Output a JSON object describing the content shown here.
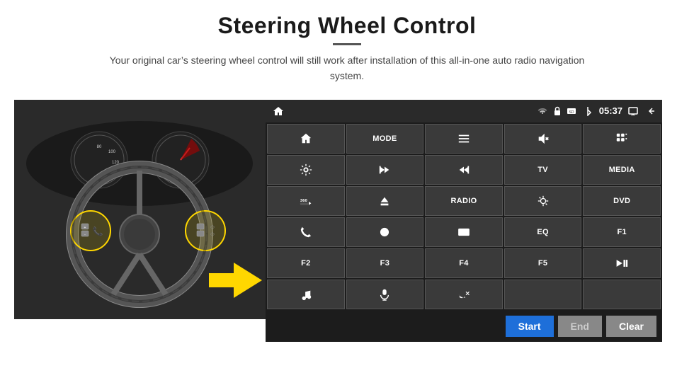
{
  "header": {
    "title": "Steering Wheel Control",
    "subtitle": "Your original car’s steering wheel control will still work after installation of this all-in-one auto radio navigation system."
  },
  "status_bar": {
    "time": "05:37"
  },
  "buttons": [
    {
      "id": "btn-home",
      "icon": "home",
      "label": ""
    },
    {
      "id": "btn-mode",
      "icon": "",
      "label": "MODE"
    },
    {
      "id": "btn-list",
      "icon": "list",
      "label": ""
    },
    {
      "id": "btn-mute",
      "icon": "mute",
      "label": ""
    },
    {
      "id": "btn-apps",
      "icon": "apps",
      "label": ""
    },
    {
      "id": "btn-nav",
      "icon": "nav",
      "label": ""
    },
    {
      "id": "btn-prev",
      "icon": "prev",
      "label": ""
    },
    {
      "id": "btn-next",
      "icon": "next",
      "label": ""
    },
    {
      "id": "btn-tv",
      "icon": "",
      "label": "TV"
    },
    {
      "id": "btn-media",
      "icon": "",
      "label": "MEDIA"
    },
    {
      "id": "btn-360",
      "icon": "360",
      "label": ""
    },
    {
      "id": "btn-eject",
      "icon": "eject",
      "label": ""
    },
    {
      "id": "btn-radio",
      "icon": "",
      "label": "RADIO"
    },
    {
      "id": "btn-bright",
      "icon": "brightness",
      "label": ""
    },
    {
      "id": "btn-dvd",
      "icon": "",
      "label": "DVD"
    },
    {
      "id": "btn-phone",
      "icon": "phone",
      "label": ""
    },
    {
      "id": "btn-swipe",
      "icon": "swipe",
      "label": ""
    },
    {
      "id": "btn-rect",
      "icon": "rect",
      "label": ""
    },
    {
      "id": "btn-eq",
      "icon": "",
      "label": "EQ"
    },
    {
      "id": "btn-f1",
      "icon": "",
      "label": "F1"
    },
    {
      "id": "btn-f2",
      "icon": "",
      "label": "F2"
    },
    {
      "id": "btn-f3",
      "icon": "",
      "label": "F3"
    },
    {
      "id": "btn-f4",
      "icon": "",
      "label": "F4"
    },
    {
      "id": "btn-f5",
      "icon": "",
      "label": "F5"
    },
    {
      "id": "btn-play",
      "icon": "play",
      "label": ""
    },
    {
      "id": "btn-music",
      "icon": "music",
      "label": ""
    },
    {
      "id": "btn-mic",
      "icon": "mic",
      "label": ""
    },
    {
      "id": "btn-call",
      "icon": "call",
      "label": ""
    },
    {
      "id": "btn-empty1",
      "icon": "",
      "label": ""
    },
    {
      "id": "btn-empty2",
      "icon": "",
      "label": ""
    }
  ],
  "action_bar": {
    "start_label": "Start",
    "end_label": "End",
    "clear_label": "Clear"
  }
}
